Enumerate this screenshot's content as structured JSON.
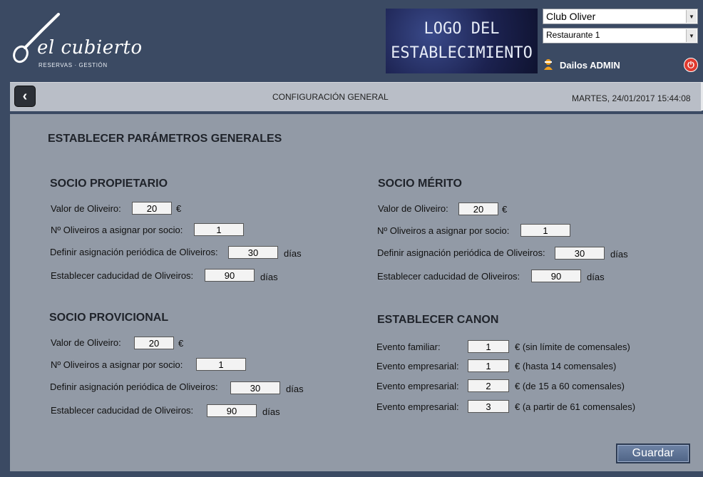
{
  "header": {
    "brand_name": "el cubierto",
    "brand_subtitle": "RESERVAS · GESTIÓN",
    "establishment_logo": [
      "LOGO DEL",
      "ESTABLECIMIENTO"
    ],
    "club_select": "Club Oliver",
    "restaurant_select": "Restaurante 1",
    "user_name": "Dailos ADMIN",
    "icons": [
      "spoon-logo-icon",
      "user-icon",
      "power-icon",
      "back-icon",
      "dropdown-arrow-icon"
    ],
    "colors": {
      "header_bg": "#3b4a63",
      "power_button": "#e03a2f",
      "user_icon": "#f0a020"
    }
  },
  "toolbar": {
    "title": "CONFIGURACIÓN GENERAL",
    "datetime": "MARTES, 24/01/2017 15:44:08"
  },
  "main": {
    "title": "ESTABLECER PARÁMETROS GENERALES",
    "socio_propietario": {
      "title": "SOCIO PROPIETARIO",
      "valor_label": "Valor de Oliveiro:",
      "valor": "20",
      "valor_unit": "€",
      "asignar_label": "Nº Oliveiros a asignar por socio:",
      "asignar": "1",
      "periodica_label": "Definir asignación periódica de Oliveiros:",
      "periodica": "30",
      "periodica_unit": "días",
      "caducidad_label": "Establecer caducidad de Oliveiros:",
      "caducidad": "90",
      "caducidad_unit": "días"
    },
    "socio_provicional": {
      "title": "SOCIO PROVICIONAL",
      "valor_label": "Valor de Oliveiro:",
      "valor": "20",
      "valor_unit": "€",
      "asignar_label": "Nº Oliveiros a asignar por socio:",
      "asignar": "1",
      "periodica_label": "Definir asignación periódica de Oliveiros:",
      "periodica": "30",
      "periodica_unit": "días",
      "caducidad_label": "Establecer caducidad de Oliveiros:",
      "caducidad": "90",
      "caducidad_unit": "días"
    },
    "socio_merito": {
      "title": "SOCIO MÉRITO",
      "valor_label": "Valor de Oliveiro:",
      "valor": "20",
      "valor_unit": "€",
      "asignar_label": "Nº Oliveiros a asignar por socio:",
      "asignar": "1",
      "periodica_label": "Definir asignación periódica de Oliveiros:",
      "periodica": "30",
      "periodica_unit": "días",
      "caducidad_label": "Establecer caducidad de Oliveiros:",
      "caducidad": "90",
      "caducidad_unit": "días"
    },
    "canon": {
      "title": "ESTABLECER CANON",
      "rows": [
        {
          "label": "Evento familiar:",
          "value": "1",
          "note": "€  (sin límite de comensales)"
        },
        {
          "label": "Evento empresarial:",
          "value": "1",
          "note": "€  (hasta 14 comensales)"
        },
        {
          "label": "Evento empresarial:",
          "value": "2",
          "note": "€  (de 15 a 60 comensales)"
        },
        {
          "label": "Evento empresarial:",
          "value": "3",
          "note": "€  (a partir de 61 comensales)"
        }
      ]
    },
    "save_label": "Guardar"
  }
}
